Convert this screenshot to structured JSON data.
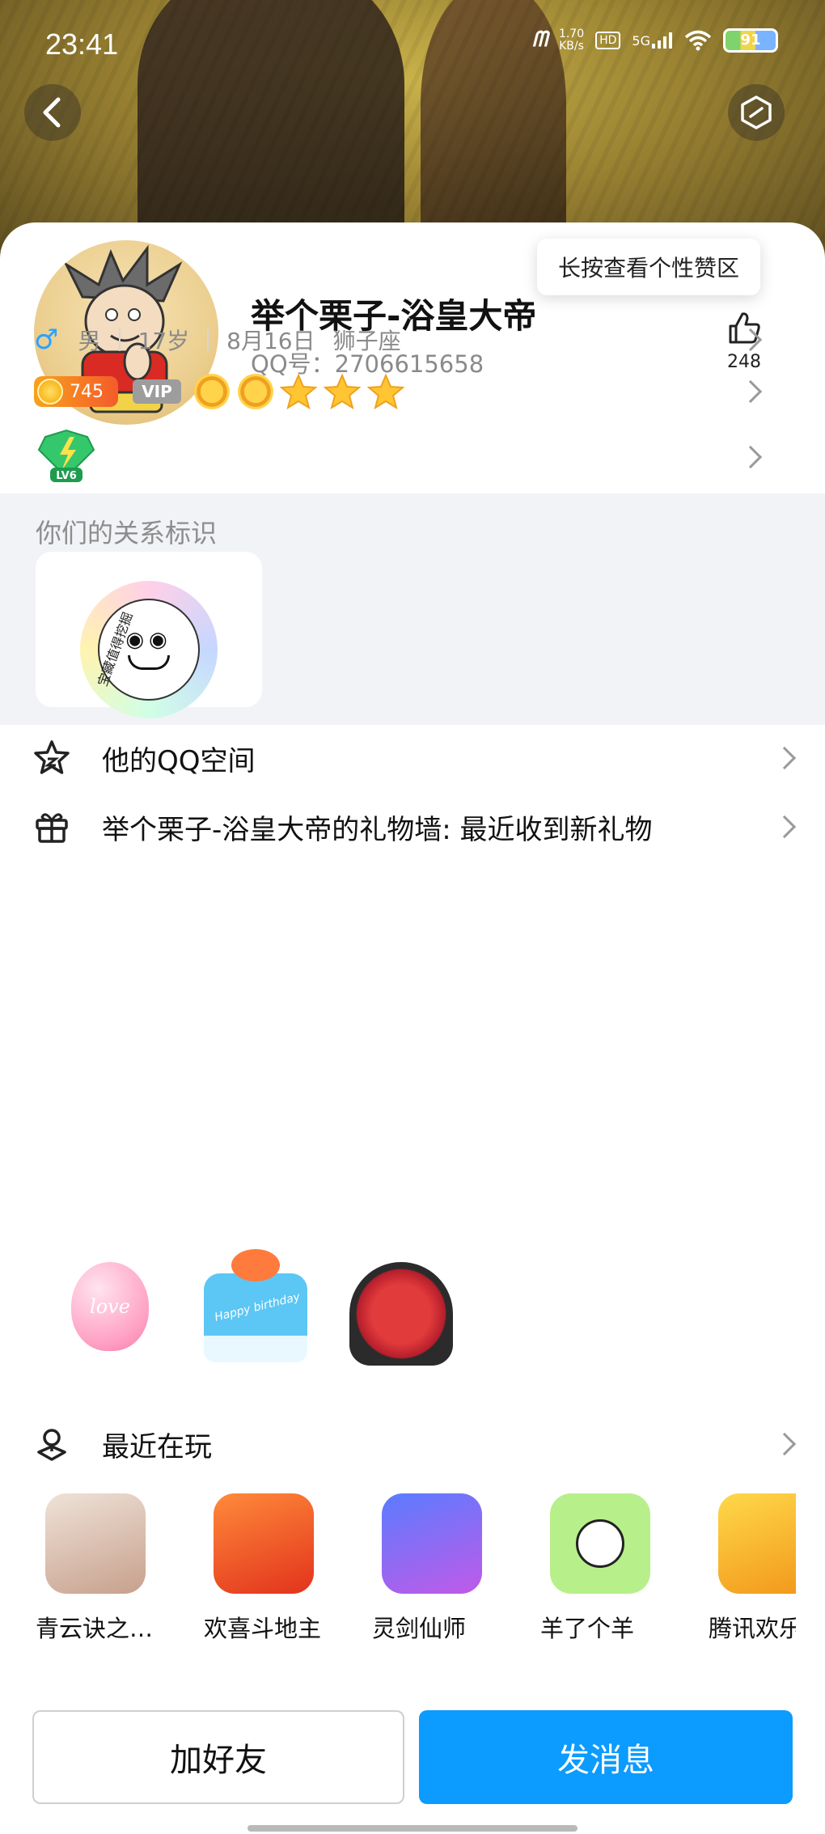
{
  "status_bar": {
    "time": "23:41",
    "net_speed_value": "1.70",
    "net_speed_unit": "KB/s",
    "hd": "HD",
    "signal": "5G",
    "battery": "91"
  },
  "profile": {
    "nickname": "举个栗子-浴皇大帝",
    "qq_label": "QQ号：2706615658",
    "like_tooltip": "长按查看个性赞区",
    "like_count": "248",
    "gender_symbol": "♂",
    "gender": "男",
    "age": "17岁",
    "birthday": "8月16日",
    "zodiac": "狮子座",
    "level_number": "745",
    "vip_label": "VIP",
    "lv_badge": "LV6"
  },
  "relationship": {
    "title": "你们的关系标识",
    "tag_ring_text": "宝藏值得挖掘"
  },
  "menu": {
    "qzone_label": "他的QQ空间",
    "gift_wall_label": "举个栗子-浴皇大帝的礼物墙: 最近收到新礼物",
    "recent_play_label": "最近在玩"
  },
  "gifts": [
    {
      "name": "balloon",
      "text": "love"
    },
    {
      "name": "birthday-cake",
      "text": "Happy birthday"
    },
    {
      "name": "rose-bouquet",
      "text": ""
    }
  ],
  "games": [
    {
      "label": "青云诀之…",
      "color": "#d9c2b6"
    },
    {
      "label": "欢喜斗地主",
      "color": "#f45a2a"
    },
    {
      "label": "灵剑仙师",
      "color": "#8a6ee8"
    },
    {
      "label": "羊了个羊",
      "color": "#b7f08a"
    },
    {
      "label": "腾讯欢乐",
      "color": "#f7b52c"
    }
  ],
  "actions": {
    "add_friend": "加好友",
    "send_message": "发消息"
  },
  "colors": {
    "accent": "#0c9bff",
    "male_blue": "#2ba2ff",
    "section_gray": "#f2f3f7"
  }
}
